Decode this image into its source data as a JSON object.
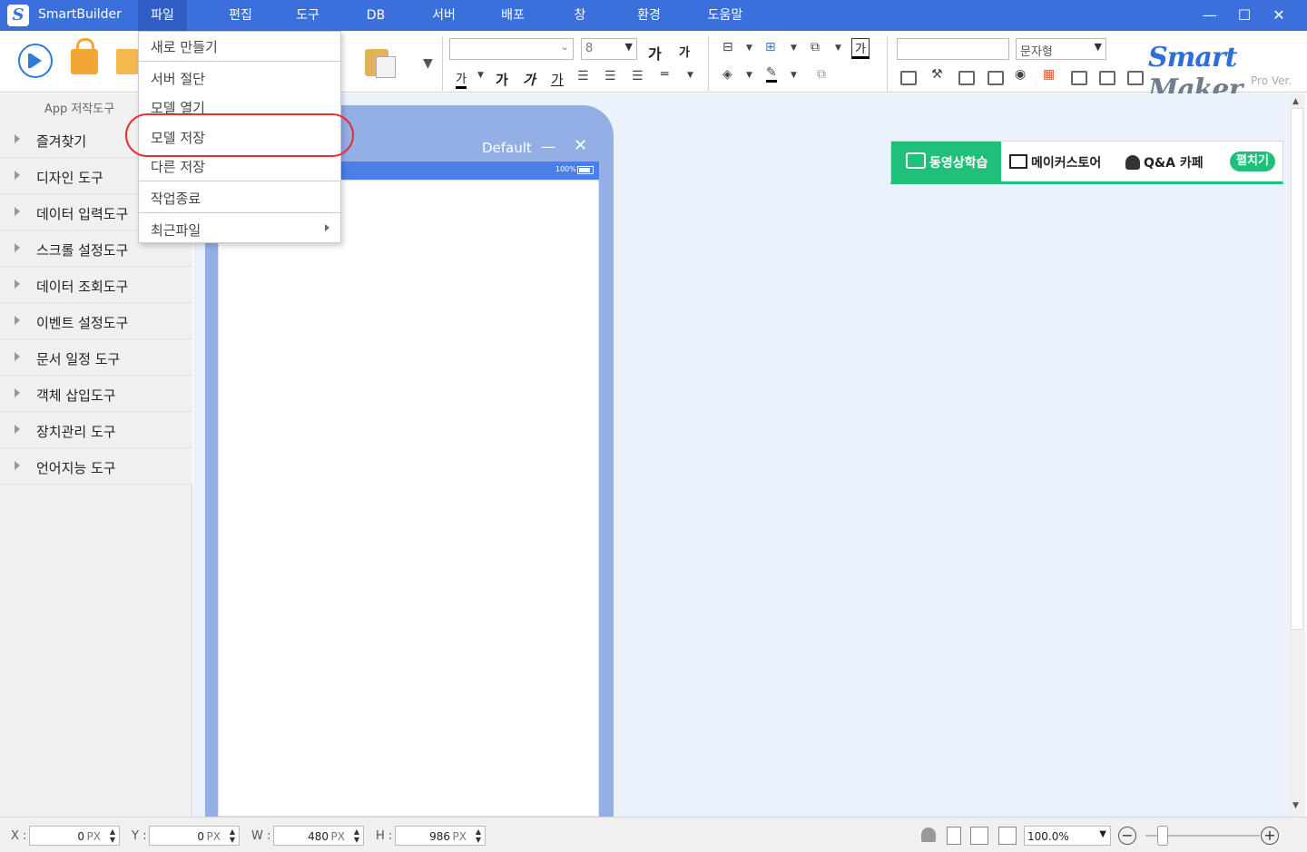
{
  "titlebar": {
    "app_title": "SmartBuilder",
    "menus": [
      "파일",
      "편집",
      "도구",
      "DB",
      "서버",
      "배포",
      "창",
      "환경",
      "도움말"
    ],
    "minimize": "—",
    "maximize": "☐",
    "close": "✕"
  },
  "toolbar": {
    "font_size": "8",
    "char_style": "문자형",
    "glyphs": {
      "ga_big": "가",
      "ga_small": "가",
      "ga_box": "가",
      "ga_color": "가",
      "ga_bold": "가",
      "ga_italic": "가",
      "ga_underline": "가"
    },
    "logo_smart": "Smart",
    "logo_maker": "Maker",
    "logo_pro": "Pro Ver."
  },
  "left_panel": {
    "title": "App 저작도구",
    "items": [
      "즐겨찾기",
      "디자인 도구",
      "데이터 입력도구",
      "스크롤 설정도구",
      "데이터 조회도구",
      "이벤트 설정도구",
      "문서 일정 도구",
      "객체 삽입도구",
      "장치관리 도구",
      "언어지능 도구"
    ]
  },
  "device": {
    "title": "Default",
    "minimize": "—",
    "close": "✕",
    "battery_text": "100%"
  },
  "banner": {
    "video": "동영상학습",
    "store": "메이커스토어",
    "qa": "Q&A 카페",
    "expand": "펼치기"
  },
  "file_menu": {
    "items": [
      "새로 만들기",
      "서버 절단",
      "모델 열기",
      "모델 저장",
      "다른 저장",
      "작업종료",
      "최근파일"
    ],
    "highlighted": "모델 저장"
  },
  "statusbar": {
    "x_label": "X :",
    "x_value": "0",
    "x_unit": "PX",
    "y_label": "Y :",
    "y_value": "0",
    "y_unit": "PX",
    "w_label": "W :",
    "w_value": "480",
    "w_unit": "PX",
    "h_label": "H :",
    "h_value": "986",
    "h_unit": "PX",
    "zoom": "100.0%",
    "zoom_out": "−",
    "zoom_in": "+"
  },
  "colors": {
    "titlebar": "#3b6fdb",
    "accent_green": "#21c07a",
    "highlight_red": "#e53030"
  }
}
